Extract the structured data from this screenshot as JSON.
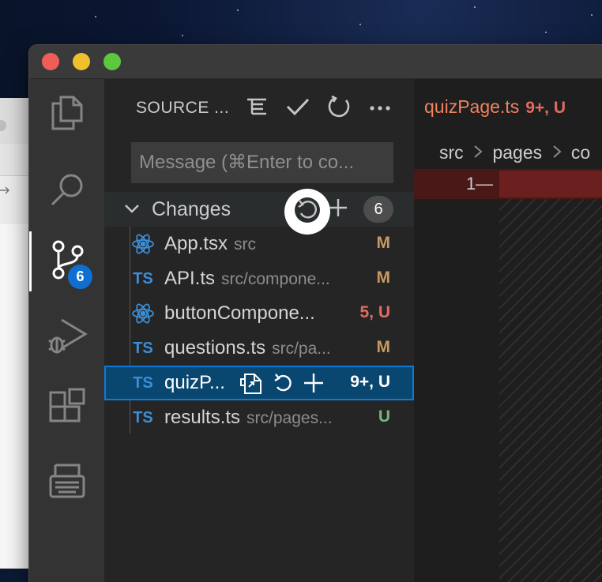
{
  "sidebar": {
    "title": "SOURCE ...",
    "actions": [
      "view-as-tree-icon",
      "commit-check-icon",
      "refresh-icon",
      "more-actions-icon"
    ],
    "message_placeholder": "Message (⌘Enter to co...",
    "changes": {
      "label": "Changes",
      "count": "6"
    },
    "files": [
      {
        "icon": "react-icon",
        "name": "App.tsx",
        "path": "src",
        "status": "M"
      },
      {
        "icon": "ts-icon",
        "name": "API.ts",
        "path": "src/compone...",
        "status": "M"
      },
      {
        "icon": "react-icon",
        "name": "buttonCompone...",
        "path": "",
        "status": "5, U"
      },
      {
        "icon": "ts-icon",
        "name": "questions.ts",
        "path": "src/pa...",
        "status": "M"
      },
      {
        "icon": "ts-icon",
        "name": "quizP...",
        "path": "",
        "status": "9+, U"
      },
      {
        "icon": "ts-icon",
        "name": "results.ts",
        "path": "src/pages...",
        "status": "U"
      }
    ],
    "ts_label": "TS"
  },
  "activity": {
    "scm_badge": "6",
    "items": [
      "explorer-icon",
      "search-icon",
      "source-control-icon",
      "run-debug-icon",
      "extensions-icon",
      "remote-explorer-icon"
    ]
  },
  "editor": {
    "tab": {
      "name": "quizPage.ts",
      "status": "9+, U"
    },
    "breadcrumb": [
      "src",
      "pages",
      "co"
    ],
    "line_number": "1",
    "line_marker": "—"
  },
  "colors": {
    "accent": "#0e6fd0",
    "selected_row": "#094771",
    "modified": "#c69a62",
    "untracked": "#73b77b",
    "error": "#e06c5f"
  }
}
